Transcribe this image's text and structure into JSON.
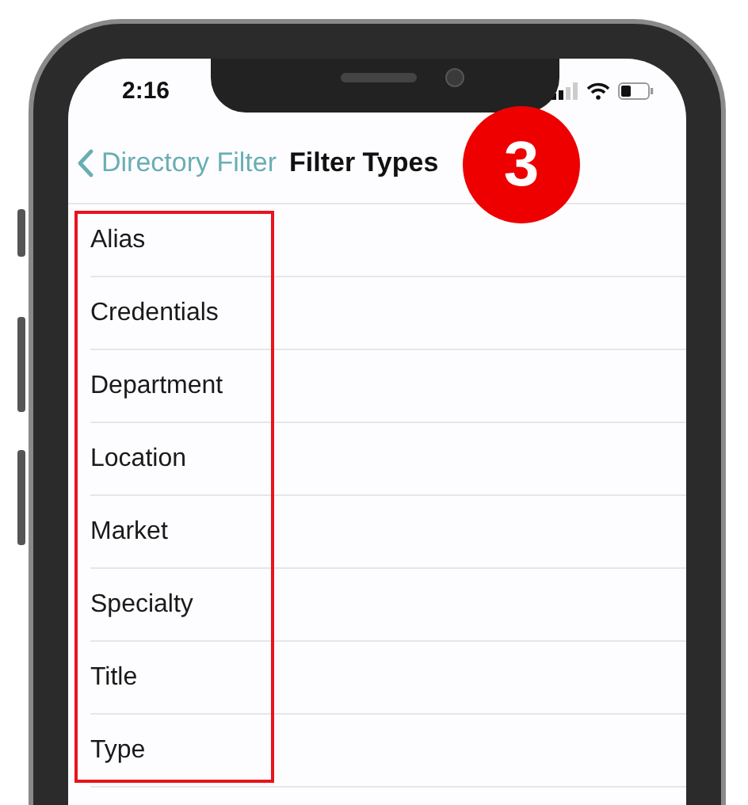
{
  "status_bar": {
    "time": "2:16"
  },
  "nav_bar": {
    "back_label": "Directory Filter",
    "title": "Filter Types"
  },
  "step_badge": {
    "label": "3"
  },
  "filter_types": [
    {
      "label": "Alias"
    },
    {
      "label": "Credentials"
    },
    {
      "label": "Department"
    },
    {
      "label": "Location"
    },
    {
      "label": "Market"
    },
    {
      "label": "Specialty"
    },
    {
      "label": "Title"
    },
    {
      "label": "Type"
    }
  ]
}
